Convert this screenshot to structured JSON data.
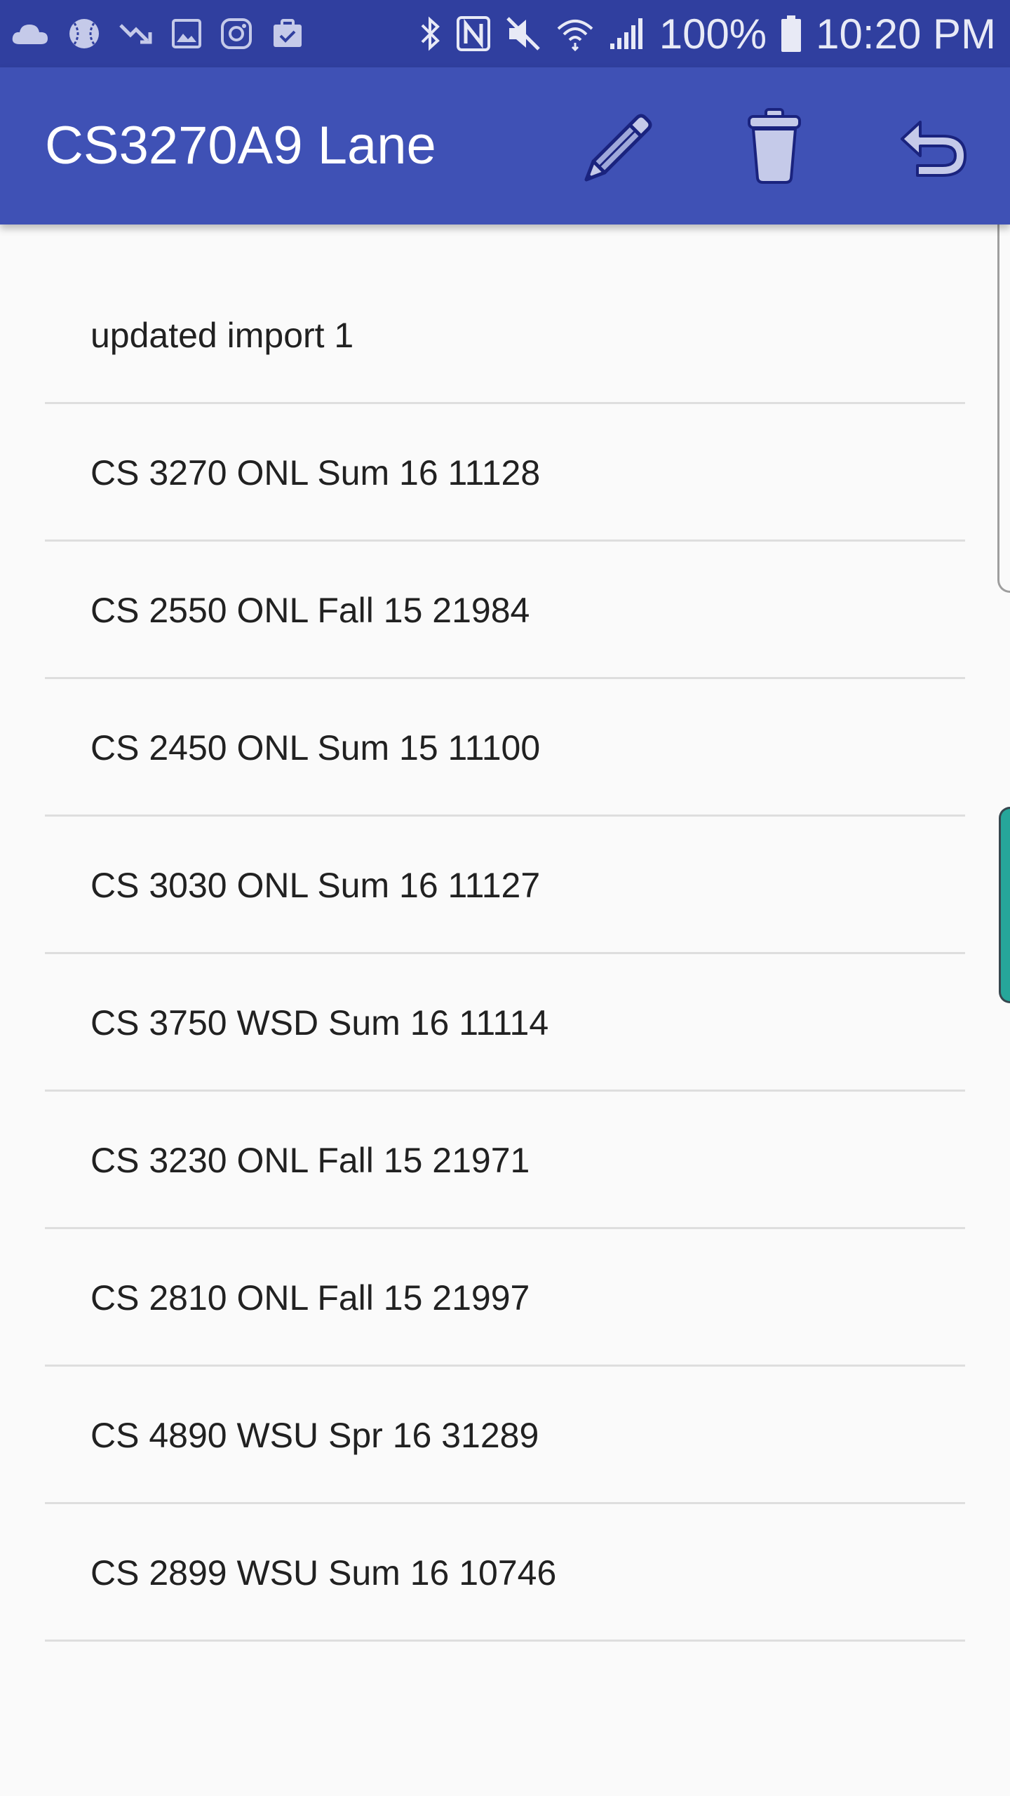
{
  "status_bar": {
    "battery_text": "100%",
    "time_text": "10:20 PM",
    "left_icons": [
      "cloud-icon",
      "baseball-icon",
      "trending-down-icon",
      "image-icon",
      "instagram-icon",
      "clipboard-check-icon"
    ],
    "right_icons": [
      "bluetooth-icon",
      "nfc-icon",
      "mute-icon",
      "wifi-icon",
      "signal-icon",
      "battery-icon"
    ]
  },
  "app_bar": {
    "title": "CS3270A9 Lane",
    "actions": [
      "pencil-icon",
      "trash-icon",
      "undo-icon"
    ]
  },
  "list": {
    "items": [
      "updated import 1",
      "CS 3270 ONL Sum 16 11128",
      "CS 2550 ONL Fall 15 21984",
      "CS 2450 ONL Sum 15 11100",
      "CS 3030 ONL Sum 16 11127",
      "CS 3750 WSD Sum 16 11114",
      "CS 3230 ONL Fall 15 21971",
      "CS 2810 ONL Fall 15 21997",
      "CS 4890 WSU Spr 16 31289",
      "CS 2899 WSU Sum 16 10746"
    ]
  },
  "colors": {
    "status_bar": "#303f9f",
    "app_bar": "#3f51b5",
    "background": "#fafafa",
    "divider": "#dedede",
    "edge_handle": "#26a69a"
  }
}
